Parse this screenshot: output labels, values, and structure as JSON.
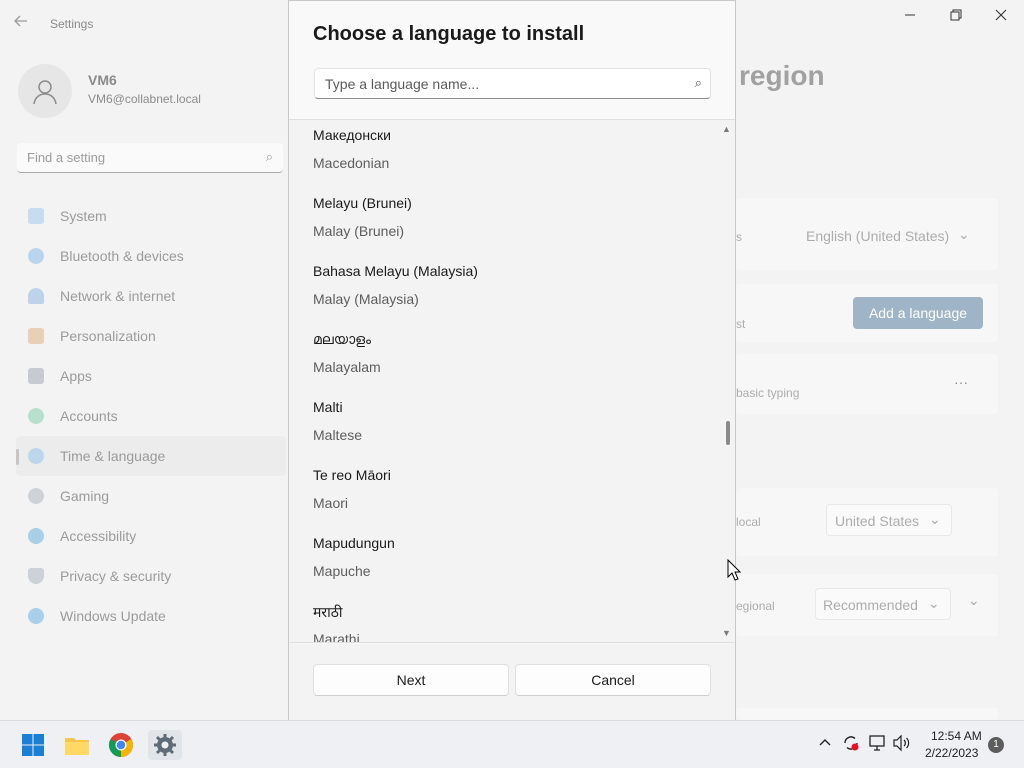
{
  "settings": {
    "app_title": "Settings",
    "user": {
      "name": "VM6",
      "email": "VM6@collabnet.local"
    },
    "search_placeholder": "Find a setting",
    "nav": [
      {
        "label": "System",
        "icon": "monitor-icon",
        "color": "#c8dcef"
      },
      {
        "label": "Bluetooth & devices",
        "icon": "bluetooth-icon",
        "color": "#b9d5ee"
      },
      {
        "label": "Network & internet",
        "icon": "wifi-icon",
        "color": "#bcd3ea"
      },
      {
        "label": "Personalization",
        "icon": "brush-icon",
        "color": "#e7d0b5"
      },
      {
        "label": "Apps",
        "icon": "apps-icon",
        "color": "#c7cbd1"
      },
      {
        "label": "Accounts",
        "icon": "person-icon",
        "color": "#b7e0cf"
      },
      {
        "label": "Time & language",
        "icon": "globe-clock-icon",
        "color": "#bcd6ec"
      },
      {
        "label": "Gaming",
        "icon": "gamepad-icon",
        "color": "#cfd3d8"
      },
      {
        "label": "Accessibility",
        "icon": "accessibility-icon",
        "color": "#a9cfe8"
      },
      {
        "label": "Privacy & security",
        "icon": "shield-icon",
        "color": "#cdd2d8"
      },
      {
        "label": "Windows Update",
        "icon": "update-icon",
        "color": "#a9cfea"
      }
    ],
    "page_heading": "region",
    "display_language_value": "English (United States)",
    "display_language_label_frag": "s",
    "preferred_label_frag": "st",
    "add_language": "Add a language",
    "basic_typing_frag": "basic typing",
    "more": "···",
    "country_label_frag": "local",
    "country_value": "United States",
    "regional_label_frag": "egional",
    "regional_value": "Recommended"
  },
  "dialog": {
    "title": "Choose a language to install",
    "search_placeholder": "Type a language name...",
    "languages": [
      {
        "native": "Македонски",
        "english": "Macedonian"
      },
      {
        "native": "Melayu (Brunei)",
        "english": "Malay (Brunei)"
      },
      {
        "native": "Bahasa Melayu (Malaysia)",
        "english": "Malay (Malaysia)"
      },
      {
        "native": "മലയാളം",
        "english": "Malayalam"
      },
      {
        "native": "Malti",
        "english": "Maltese"
      },
      {
        "native": "Te reo Māori",
        "english": "Maori"
      },
      {
        "native": "Mapudungun",
        "english": "Mapuche"
      },
      {
        "native": "मराठी",
        "english": "Marathi"
      }
    ],
    "next": "Next",
    "cancel": "Cancel"
  },
  "taskbar": {
    "time": "12:54 AM",
    "date": "2/22/2023",
    "notifications": "1"
  }
}
